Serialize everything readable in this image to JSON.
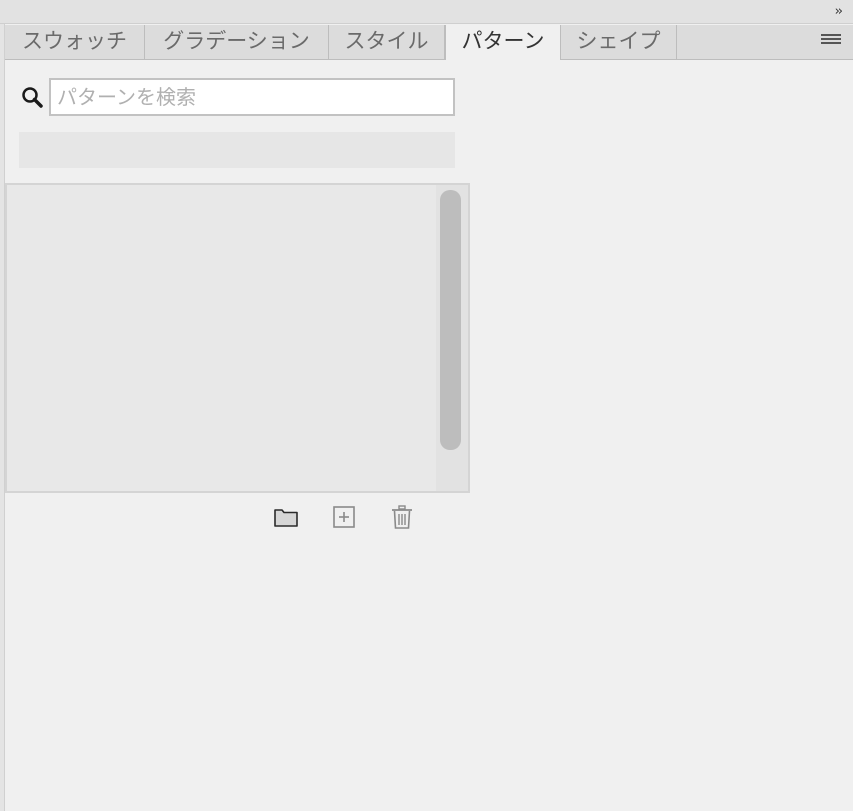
{
  "panel": {
    "collapse_label": "››",
    "tabs": [
      {
        "label": "スウォッチ",
        "active": false
      },
      {
        "label": "グラデーション",
        "active": false
      },
      {
        "label": "スタイル",
        "active": false
      },
      {
        "label": "パターン",
        "active": true
      },
      {
        "label": "シェイプ",
        "active": false
      }
    ],
    "menu_icon": "hamburger-menu-icon"
  },
  "search": {
    "placeholder": "パターンを検索",
    "value": "",
    "icon": "search-icon"
  },
  "footer": {
    "buttons": [
      {
        "icon": "folder-icon"
      },
      {
        "icon": "add-pattern-icon"
      },
      {
        "icon": "trash-icon"
      }
    ]
  },
  "colors": {
    "panel_bg": "#f0f0f0",
    "tab_bar_bg": "#dcdcdc",
    "active_tab_bg": "#f0f0f0",
    "scroll_thumb": "#bdbdbd",
    "list_bg": "#e8e8e8"
  }
}
